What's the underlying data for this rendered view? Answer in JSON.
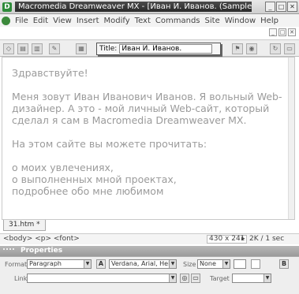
{
  "window": {
    "title": "Macromedia Dreamweaver MX - [Иван И. Иванов. (Samples/...",
    "app_icon": "dreamweaver-logo",
    "buttons": [
      "_",
      "□",
      "✕"
    ]
  },
  "menu": {
    "items": [
      "File",
      "Edit",
      "View",
      "Insert",
      "Modify",
      "Text",
      "Commands",
      "Site",
      "Window",
      "Help"
    ],
    "doc_buttons": [
      "_",
      "□",
      "✕"
    ]
  },
  "toolbar": {
    "title_label": "Title:",
    "title_value": "Иван И. Иванов."
  },
  "document": {
    "greeting": "Здравствуйте!",
    "intro": "Меня зовут Иван Иванович Иванов. Я вольный Web-дизайнер. А это - мой личный Web-сайт, который сделал я сам в Macromedia Dreamweaver MX.",
    "site_lead": "На этом сайте вы можете прочитать:",
    "items": [
      "о моих увлечениях,",
      "о выполненных мной проектах,",
      "подробнее обо мне любимом"
    ]
  },
  "doc_tab": {
    "label": "31.htm *"
  },
  "status": {
    "tag_selector": "<body> <p> <font>",
    "window_size": "430 x 241",
    "download": "2K / 1 sec"
  },
  "properties": {
    "title": "Properties",
    "format_label": "Format",
    "format_value": "Paragraph",
    "font_value": "Verdana, Arial, Helv",
    "size_label": "Size",
    "size_value": "None",
    "link_label": "Link",
    "target_label": "Target",
    "bold_label": "B"
  }
}
